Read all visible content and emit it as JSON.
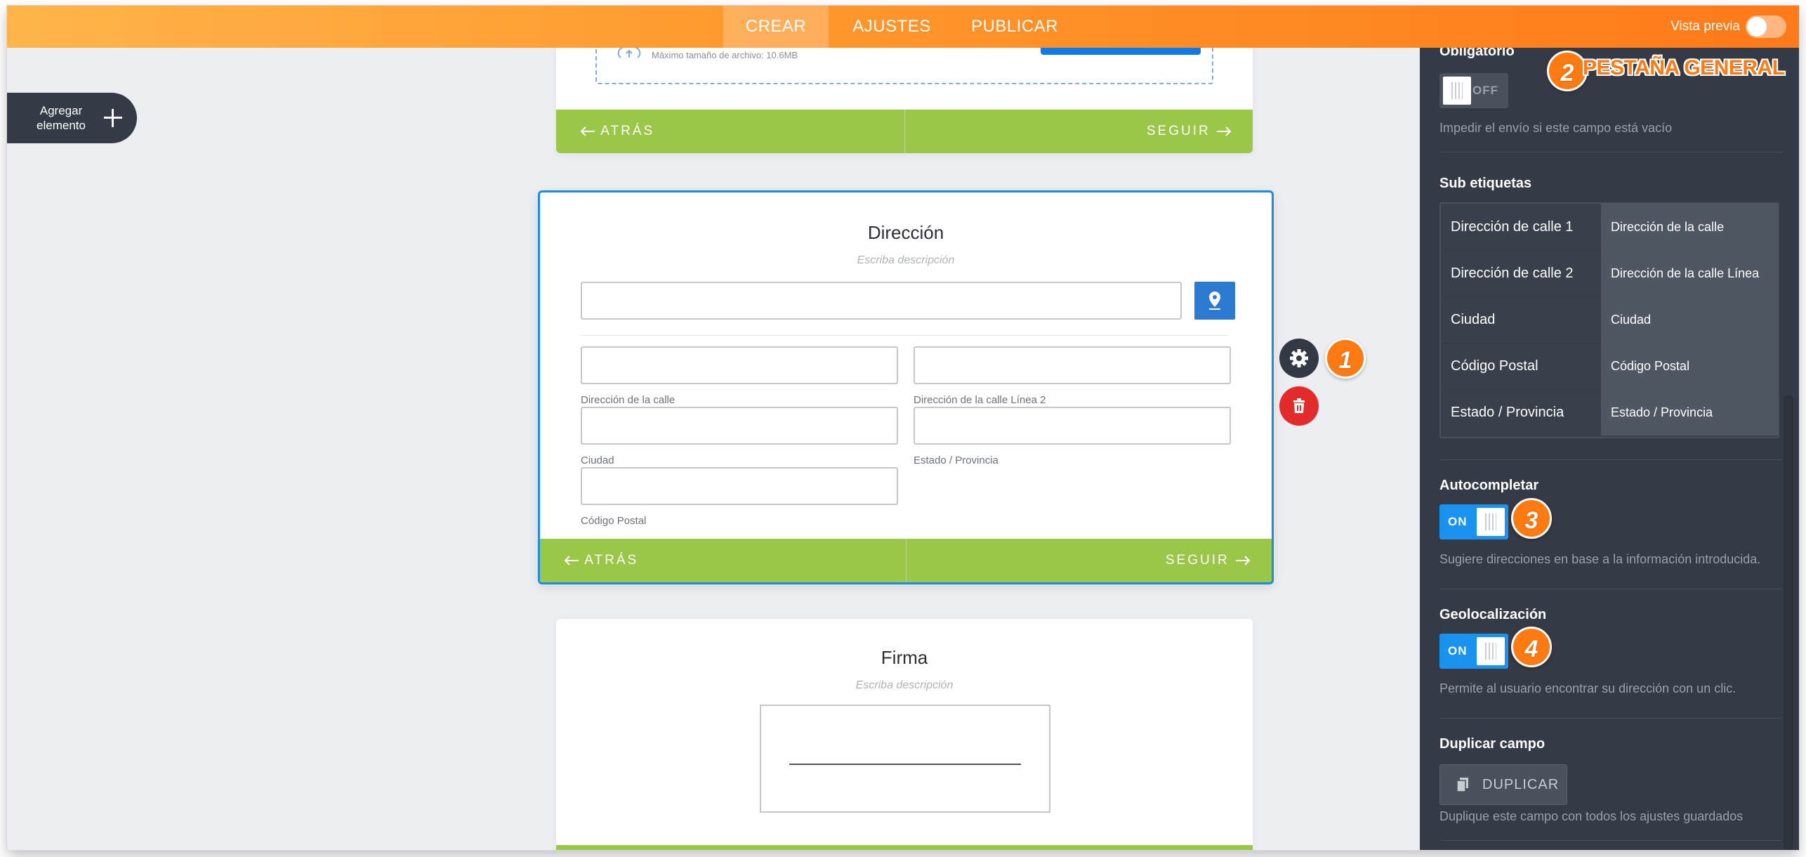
{
  "topbar": {
    "tabs": [
      {
        "label": "CREAR",
        "active": true
      },
      {
        "label": "AJUSTES",
        "active": false
      },
      {
        "label": "PUBLICAR",
        "active": false
      }
    ],
    "preview_label": "Vista previa",
    "preview_enabled": false
  },
  "add_element": {
    "label": "Agregar elemento"
  },
  "upload_card": {
    "max_size_text": "Máximo tamaño de archivo: 10.6MB",
    "back_label": "ATRÁS",
    "next_label": "SEGUIR"
  },
  "address_card": {
    "title": "Dirección",
    "description_placeholder": "Escriba descripción",
    "sublabels": {
      "street1": "Dirección de la calle",
      "street2": "Dirección de la calle Línea 2",
      "city": "Ciudad",
      "state": "Estado / Provincia",
      "postal": "Código Postal"
    },
    "back_label": "ATRÁS",
    "next_label": "SEGUIR"
  },
  "signature_card": {
    "title": "Firma",
    "description_placeholder": "Escriba descripción"
  },
  "annotations": {
    "badge1": "1",
    "badge2": "2",
    "badge2_caption": "PESTAÑA GENERAL",
    "badge3": "3",
    "badge4": "4",
    "accent_color": "#ff7a10"
  },
  "panel": {
    "required": {
      "title": "Obligatorio",
      "state": "OFF",
      "help": "Impedir el envío si este campo está vacío"
    },
    "sublabels": {
      "title": "Sub etiquetas",
      "rows": [
        {
          "key": "Dirección de calle 1",
          "value": "Dirección de la calle"
        },
        {
          "key": "Dirección de calle 2",
          "value": "Dirección de la calle Línea"
        },
        {
          "key": "Ciudad",
          "value": "Ciudad"
        },
        {
          "key": "Código Postal",
          "value": "Código Postal"
        },
        {
          "key": "Estado / Provincia",
          "value": "Estado / Provincia"
        }
      ]
    },
    "autocomplete": {
      "title": "Autocompletar",
      "state": "ON",
      "help": "Sugiere direcciones en base a la información introducida."
    },
    "geolocation": {
      "title": "Geolocalización",
      "state": "ON",
      "help": "Permite al usuario encontrar su dirección con un clic."
    },
    "duplicate": {
      "title": "Duplicar campo",
      "button": "DUPLICAR",
      "help": "Duplique este campo con todos los ajustes guardados"
    }
  },
  "colors": {
    "topbar_start": "#ffb54a",
    "topbar_end": "#ff7a18",
    "nav_green": "#9ac748",
    "selection_blue": "#1a8ee0",
    "panel_bg": "#353b46",
    "toggle_on": "#1a92f0",
    "delete_red": "#e42b2b"
  }
}
